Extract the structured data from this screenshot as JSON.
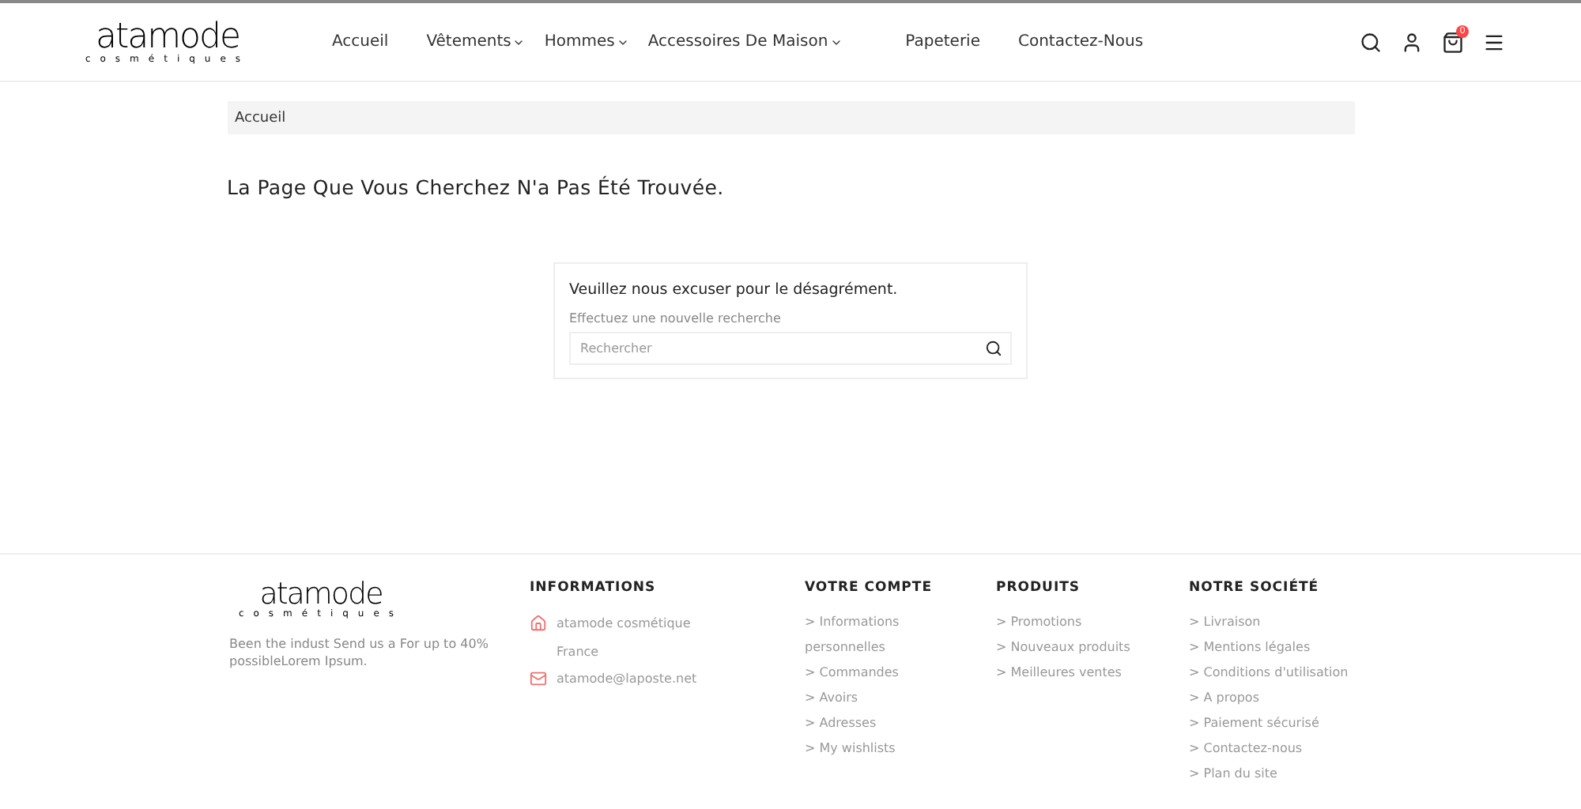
{
  "header": {
    "logo": {
      "word": "atamode",
      "tagline": "cosmétiques"
    },
    "nav": [
      {
        "label": "Accueil",
        "dropdown": false
      },
      {
        "label": "Vêtements",
        "dropdown": true
      },
      {
        "label": "Hommes",
        "dropdown": true
      },
      {
        "label": "Accessoires De Maison",
        "dropdown": true
      },
      {
        "label": "Papeterie",
        "dropdown": false
      },
      {
        "label": "Contactez-Nous",
        "dropdown": false
      }
    ],
    "cart_count": "0"
  },
  "breadcrumb": [
    "Accueil"
  ],
  "page_title": "La Page Que Vous Cherchez N'a Pas Été Trouvée.",
  "search_card": {
    "heading": "Veuillez nous excuser pour le désagrément.",
    "hint": "Effectuez une nouvelle recherche",
    "placeholder": "Rechercher"
  },
  "footer": {
    "logo": {
      "word": "atamode",
      "tagline": "cosmétiques"
    },
    "about": "Been the indust Send us a For up to 40% possibleLorem Ipsum.",
    "info": {
      "title": "INFORMATIONS",
      "items": [
        {
          "kind": "address",
          "lines": [
            "atamode cosmétique",
            "France"
          ]
        },
        {
          "kind": "email",
          "lines": [
            "atamode@laposte.net"
          ]
        }
      ]
    },
    "columns": [
      {
        "title": "VOTRE COMPTE",
        "links": [
          "> Informations personnelles",
          "> Commandes",
          "> Avoirs",
          "> Adresses",
          "> My wishlists"
        ]
      },
      {
        "title": "PRODUITS",
        "links": [
          "> Promotions",
          "> Nouveaux produits",
          "> Meilleures ventes"
        ]
      },
      {
        "title": "NOTRE SOCIÉTÉ",
        "links": [
          "> Livraison",
          "> Mentions légales",
          "> Conditions d'utilisation",
          "> A propos",
          "> Paiement sécurisé",
          "> Contactez-nous",
          "> Plan du site"
        ]
      }
    ]
  }
}
